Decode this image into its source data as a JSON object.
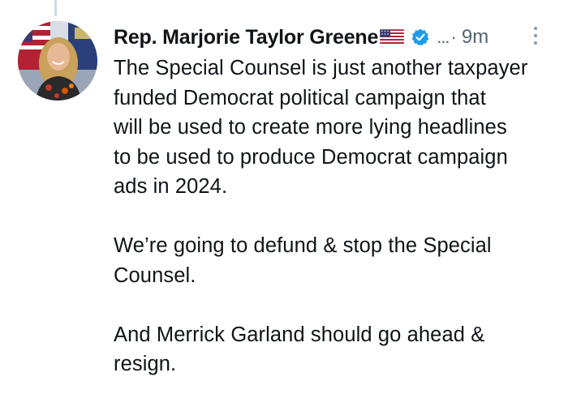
{
  "tweet": {
    "display_name": "Rep. Marjorie Taylor Greene",
    "flag_emoji_name": "us-flag-icon",
    "verified_badge": "verified-icon",
    "verified_color": "#1d9bf0",
    "handle_truncated": "...",
    "separator": "·",
    "timestamp": "9m",
    "paragraphs": [
      {
        "lines": [
          "The Special Counsel is just another taxpayer",
          "funded Democrat political campaign that",
          "will be used to create more lying headlines",
          "to be used to produce Democrat campaign",
          "ads in 2024."
        ]
      },
      {
        "lines": [
          "We’re going to defund & stop the Special",
          "Counsel."
        ]
      },
      {
        "lines": [
          "And Merrick Garland should go ahead &",
          "resign."
        ]
      }
    ]
  }
}
